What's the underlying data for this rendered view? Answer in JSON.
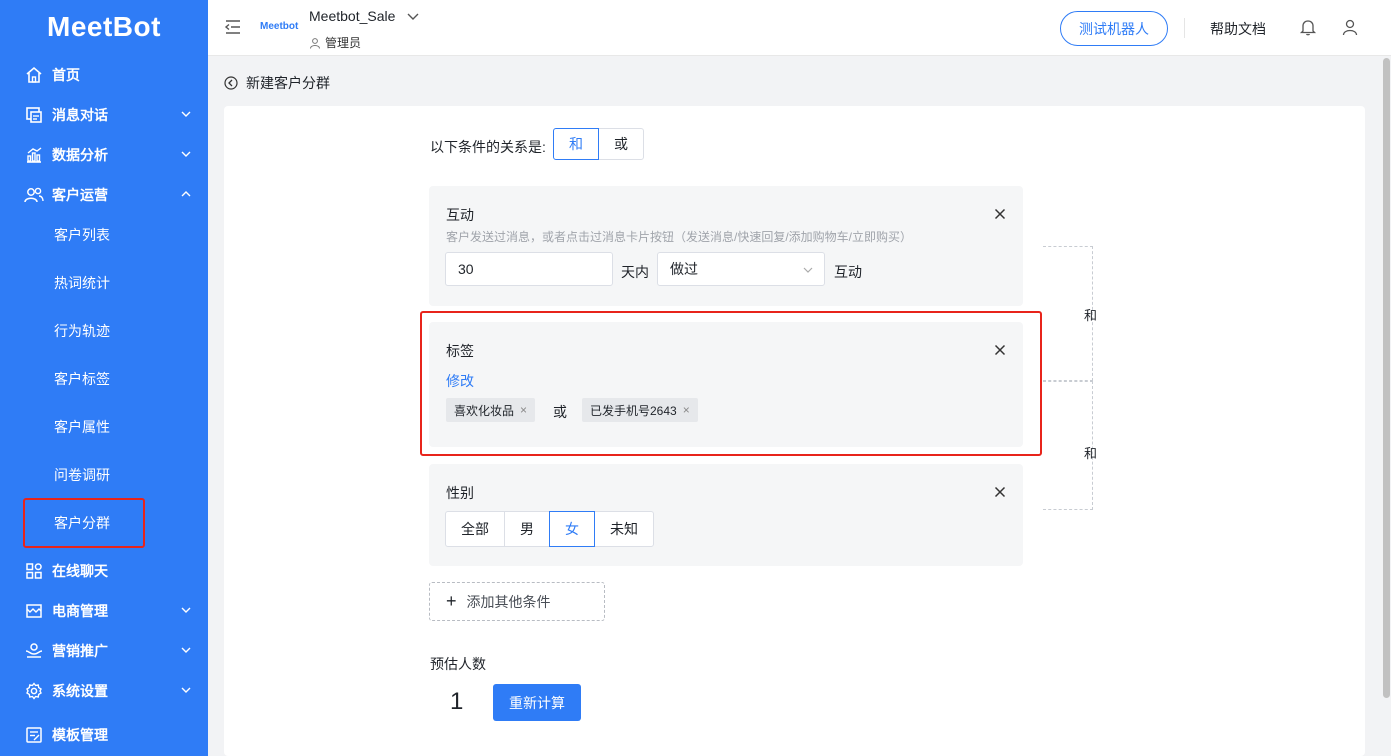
{
  "sidebar": {
    "logo": "MeetBot",
    "items": [
      {
        "label": "首页",
        "icon": "home-icon"
      },
      {
        "label": "消息对话",
        "icon": "message-icon"
      },
      {
        "label": "数据分析",
        "icon": "chart-icon"
      },
      {
        "label": "客户运营",
        "icon": "users-icon"
      },
      {
        "label": "在线聊天",
        "icon": "apps-icon"
      },
      {
        "label": "电商管理",
        "icon": "shop-icon"
      },
      {
        "label": "营销推广",
        "icon": "megaphone-icon"
      },
      {
        "label": "系统设置",
        "icon": "gear-icon"
      },
      {
        "label": "模板管理",
        "icon": "template-icon"
      }
    ],
    "sub_items": [
      {
        "label": "客户列表"
      },
      {
        "label": "热词统计"
      },
      {
        "label": "行为轨迹"
      },
      {
        "label": "客户标签"
      },
      {
        "label": "客户属性"
      },
      {
        "label": "问卷调研"
      },
      {
        "label": "客户分群"
      }
    ]
  },
  "header": {
    "brand_small": "Meetbot",
    "app_name": "Meetbot_Sale",
    "role": "管理员",
    "test_button": "测试机器人",
    "help": "帮助文档"
  },
  "page": {
    "back_title": "新建客户分群",
    "relation_label": "以下条件的关系是:",
    "relation_options": [
      "和",
      "或"
    ],
    "relation_selected": "和"
  },
  "conditions": {
    "interaction": {
      "title": "互动",
      "desc": "客户发送过消息，或者点击过消息卡片按钮（发送消息/快速回复/添加购物车/立即购买）",
      "days_value": "30",
      "days_unit": "天内",
      "action_value": "做过",
      "suffix": "互动"
    },
    "tag": {
      "title": "标签",
      "edit_link": "修改",
      "tags": [
        "喜欢化妆品",
        "已发手机号2643"
      ],
      "joiner": "或"
    },
    "gender": {
      "title": "性别",
      "options": [
        "全部",
        "男",
        "女",
        "未知"
      ],
      "selected": "女"
    },
    "bracket_labels": [
      "和",
      "和"
    ]
  },
  "add_condition": "添加其他条件",
  "estimate": {
    "label": "预估人数",
    "value": "1",
    "recalc": "重新计算"
  },
  "colors": {
    "primary": "#2f7cf6",
    "highlight": "#e8241b"
  }
}
